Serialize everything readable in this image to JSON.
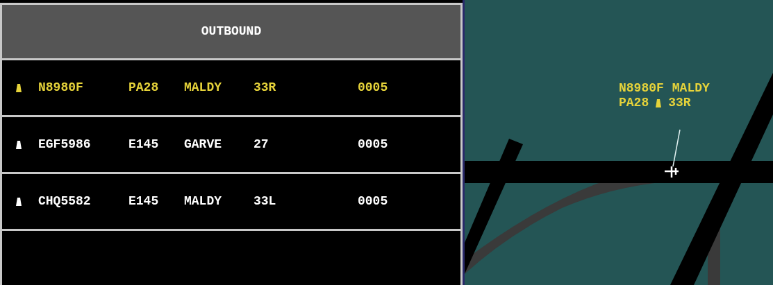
{
  "flight_list": {
    "title": "OUTBOUND",
    "rows": [
      {
        "callsign": "N8980F",
        "type": "PA28",
        "fix": "MALDY",
        "runway": "33R",
        "time": "0005",
        "selected": true
      },
      {
        "callsign": "EGF5986",
        "type": "E145",
        "fix": "GARVE",
        "runway": "27",
        "time": "0005",
        "selected": false
      },
      {
        "callsign": "CHQ5582",
        "type": "E145",
        "fix": "MALDY",
        "runway": "33L",
        "time": "0005",
        "selected": false
      }
    ]
  },
  "map": {
    "data_block": {
      "callsign": "N8980F",
      "fix": "MALDY",
      "type": "PA28",
      "runway": "33R"
    }
  }
}
